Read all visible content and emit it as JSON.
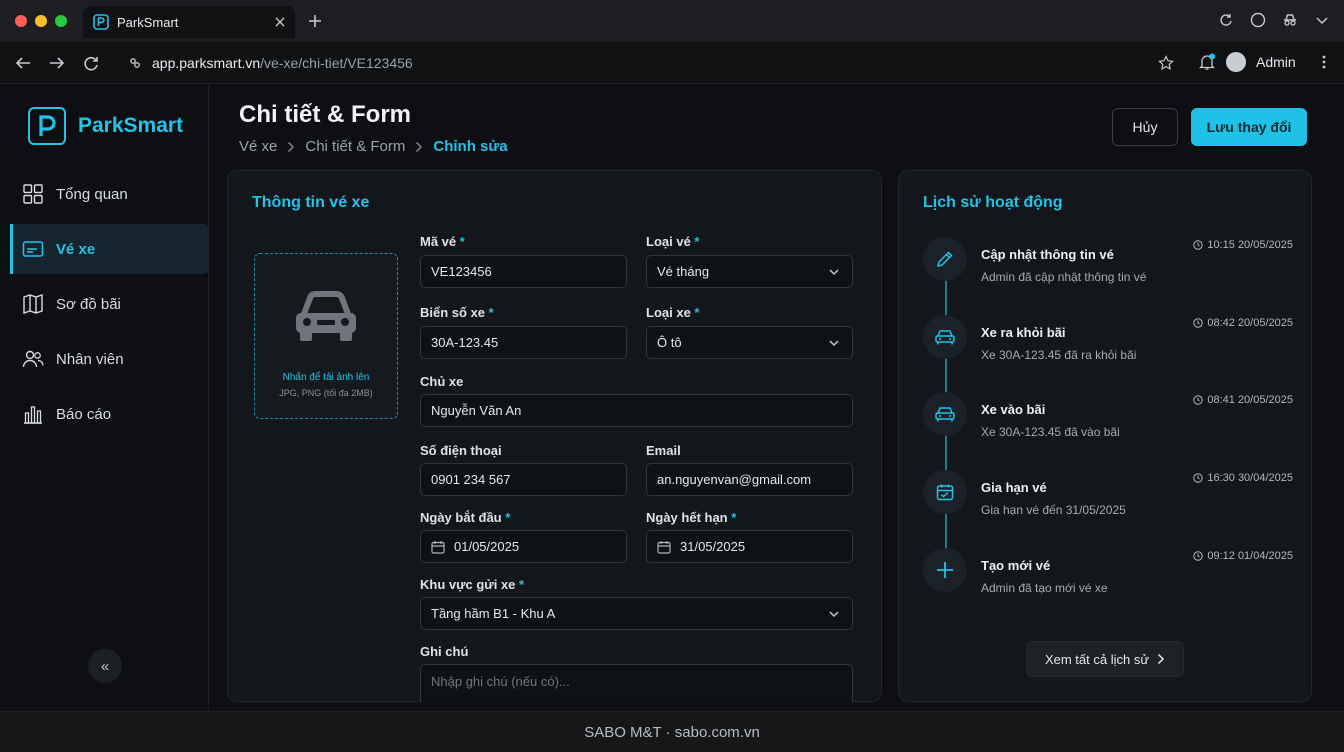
{
  "browser": {
    "tab_title": "ParkSmart",
    "url_host": "app.parksmart.vn",
    "url_path": "/ve-xe/chi-tiet/VE123456",
    "user_name": "Admin"
  },
  "sidebar": {
    "brand": "ParkSmart",
    "items": [
      {
        "label": "Tổng quan",
        "icon": "grid-icon"
      },
      {
        "label": "Vé xe",
        "icon": "ticket-icon"
      },
      {
        "label": "Sơ đồ bãi",
        "icon": "map-icon"
      },
      {
        "label": "Nhân viên",
        "icon": "users-icon"
      },
      {
        "label": "Báo cáo",
        "icon": "bar-chart-icon"
      }
    ],
    "collapse_label": "«"
  },
  "header": {
    "title": "Chi tiết & Form",
    "breadcrumb": [
      "Vé xe",
      "Chi tiết & Form",
      "Chỉnh sửa"
    ],
    "cancel_label": "Hủy",
    "save_label": "Lưu thay đổi"
  },
  "form": {
    "title": "Thông tin vé xe",
    "upload_title": "Nhấn để tải ảnh lên",
    "upload_hint": "JPG, PNG (tối đa 2MB)",
    "ticket_code": {
      "label": "Mã vé",
      "value": "VE123456"
    },
    "ticket_type": {
      "label": "Loại vé",
      "value": "Vé tháng"
    },
    "plate": {
      "label": "Biển số xe",
      "value": "30A-123.45"
    },
    "vehicle_type": {
      "label": "Loại xe",
      "value": "Ô tô"
    },
    "owner": {
      "label": "Chủ xe",
      "value": "Nguyễn Văn An"
    },
    "phone": {
      "label": "Số điện thoại",
      "value": "0901 234 567"
    },
    "email": {
      "label": "Email",
      "value": "an.nguyenvan@gmail.com"
    },
    "start_date": {
      "label": "Ngày bắt đầu",
      "value": "01/05/2025"
    },
    "end_date": {
      "label": "Ngày hết hạn",
      "value": "31/05/2025"
    },
    "zone": {
      "label": "Khu vực gửi xe",
      "value": "Tầng hầm B1 - Khu A"
    },
    "note": {
      "label": "Ghi chú",
      "placeholder": "Nhập ghi chú (nếu có)..."
    },
    "required_mark": "*"
  },
  "history": {
    "title": "Lịch sử hoạt động",
    "items": [
      {
        "title": "Cập nhật thông tin vé",
        "desc": "Admin đã cập nhật thông tin vé",
        "time": "10:15 20/05/2025",
        "icon": "pencil-icon"
      },
      {
        "title": "Xe ra khỏi bãi",
        "desc": "Xe 30A-123.45 đã ra khỏi bãi",
        "time": "08:42 20/05/2025",
        "icon": "car-icon"
      },
      {
        "title": "Xe vào bãi",
        "desc": "Xe 30A-123.45 đã vào bãi",
        "time": "08:41 20/05/2025",
        "icon": "car-icon"
      },
      {
        "title": "Gia hạn vé",
        "desc": "Gia hạn vé đến 31/05/2025",
        "time": "16:30 30/04/2025",
        "icon": "calendar-icon"
      },
      {
        "title": "Tạo mới vé",
        "desc": "Admin đã tạo mới vé xe",
        "time": "09:12 01/04/2025",
        "icon": "plus-icon"
      }
    ],
    "view_all_label": "Xem tất cả lịch sử"
  },
  "footer": {
    "text": "SABO M&T · sabo.com.vn"
  },
  "colors": {
    "accent": "#22c3e6",
    "background": "#0d0f12",
    "card": "#13161a"
  }
}
